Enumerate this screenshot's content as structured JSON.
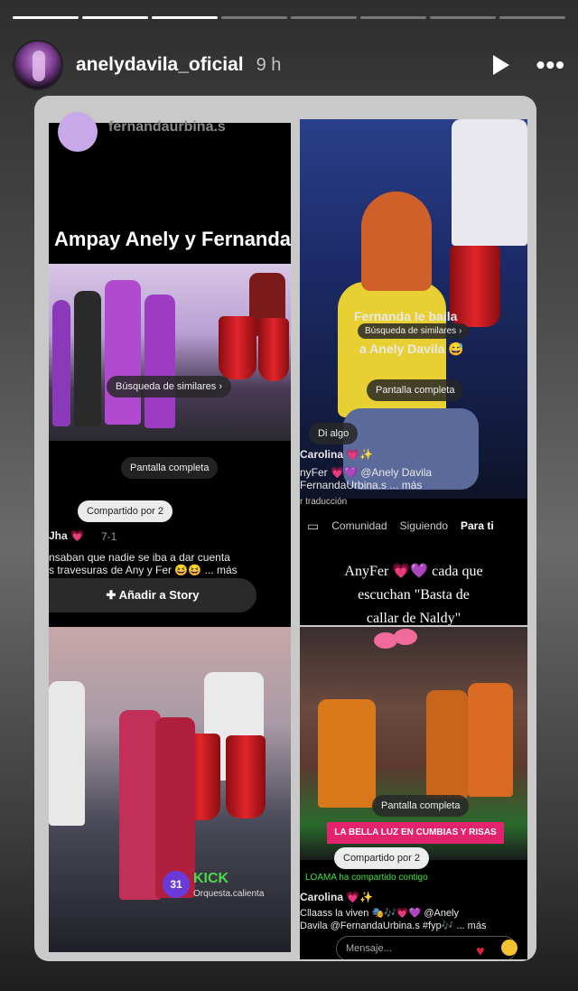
{
  "story": {
    "progress": [
      1,
      1,
      1,
      0,
      0,
      0,
      0,
      0
    ],
    "username": "anelydavila_oficial",
    "time": "9 h",
    "play_icon": "play-icon",
    "more_icon": "more-options-icon"
  },
  "tiles": {
    "top_left": {
      "handle": "fernandaurbina.s",
      "title": "Ampay Anely y Fernanda",
      "search_similar": "Búsqueda de similares ›",
      "fullscreen": "Pantalla completa",
      "shared_by": "Compartido por 2",
      "commenter": "Jha 💗",
      "comment_meta": "7-1",
      "comment_line1": "nsaban que nadie se iba a dar cuenta",
      "comment_line2": "s travesuras de Any y Fer 😆😆 ... más",
      "add_story": "Añadir a Story"
    },
    "top_right": {
      "overlay_line1": "Fernanda le baila",
      "overlay_line2": "a Anely Davila 😅",
      "search_similar": "Búsqueda de similares ›",
      "fullscreen": "Pantalla completa",
      "say_something": "Di algo",
      "commenter": "Carolina 💗✨",
      "caption_line1": "nyFer 💗💜 @Anely Davila",
      "caption_line2": "FernandaUrbina.s ... más",
      "translation": "r traducción",
      "tabs": [
        "Comunidad",
        "Siguiendo",
        "Para ti"
      ],
      "anyfer_line1": "AnyFer 💗💜 cada que",
      "anyfer_line2": "escuchan \"Basta de",
      "anyfer_line3": "callar de Naldy\""
    },
    "bottom_left": {
      "kick_label": "KICK",
      "kick_sub": "Orquesta.calienta",
      "kick_avatar": "31"
    },
    "bottom_right": {
      "fullscreen": "Pantalla completa",
      "banner": "LA BELLA LUZ EN CUMBIAS Y RISAS",
      "shared_by": "Compartido por 2",
      "shared_notice": "LOAMA ha compartido contigo",
      "commenter": "Carolina 💗✨",
      "caption_line1": "Cllaass la viven 🎭🎶💗💜 @Anely",
      "caption_line2": "Davila @FernandaUrbina.s #fyp🎶 ... más",
      "message_placeholder": "Mensaje..."
    }
  }
}
